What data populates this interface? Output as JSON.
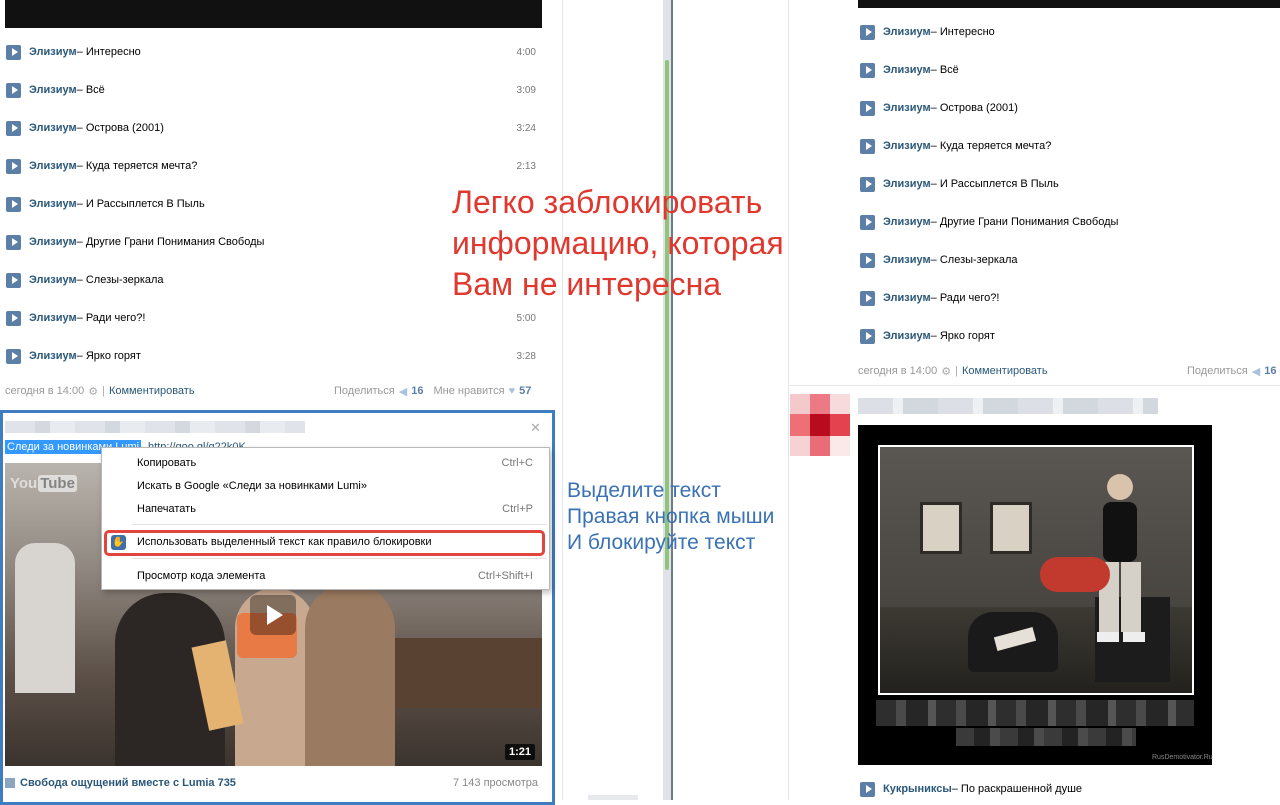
{
  "left_feed": {
    "audio": [
      {
        "artist": "Элизиум",
        "title": " – Интересно",
        "duration": "4:00"
      },
      {
        "artist": "Элизиум",
        "title": " – Всё",
        "duration": "3:09"
      },
      {
        "artist": "Элизиум",
        "title": " – Острова (2001)",
        "duration": "3:24"
      },
      {
        "artist": "Элизиум",
        "title": " – Куда теряется мечта?",
        "duration": "2:13"
      },
      {
        "artist": "Элизиум",
        "title": " – И Рассыплется В Пыль",
        "duration": ""
      },
      {
        "artist": "Элизиум",
        "title": " – Другие Грани Понимания Свободы",
        "duration": ""
      },
      {
        "artist": "Элизиум",
        "title": " – Слезы-зеркала",
        "duration": ""
      },
      {
        "artist": "Элизиум",
        "title": " – Ради чего?!",
        "duration": "5:00"
      },
      {
        "artist": "Элизиум",
        "title": " – Ярко горят",
        "duration": "3:28"
      }
    ],
    "meta": {
      "date": "сегодня в 14:00",
      "separator": "|",
      "comment": "Комментировать",
      "share": "Поделиться",
      "share_count": "16",
      "like": "Мне нравится",
      "like_count": "57"
    },
    "post": {
      "selected_text": "Следи за новинками Lumi",
      "url_text": "http://goo.gl/q22k0K",
      "close": "✕",
      "video": {
        "youtube_logo": "You",
        "youtube_logo_tube": "Tube",
        "duration": "1:21",
        "title": "Свобода ощущений вместе с Lumia 735",
        "views": "7 143 просмотра"
      }
    }
  },
  "context_menu": {
    "items": [
      {
        "label": "Копировать",
        "shortcut": "Ctrl+C"
      },
      {
        "label": "Искать в Google «Следи за новинками Lumi»",
        "shortcut": ""
      },
      {
        "label": "Напечатать",
        "shortcut": "Ctrl+P"
      },
      {
        "label": "Использовать выделенный текст как правило блокировки",
        "shortcut": ""
      },
      {
        "label": "Просмотр кода элемента",
        "shortcut": "Ctrl+Shift+I"
      }
    ]
  },
  "annotations": {
    "red": [
      "Легко заблокировать",
      "информацию, которая",
      "Вам не интересна"
    ],
    "blue": [
      "Выделите текст",
      "Правая кнопка мыши",
      "И блокируйте текст"
    ]
  },
  "right_feed": {
    "audio": [
      {
        "artist": "Элизиум",
        "title": " – Интересно"
      },
      {
        "artist": "Элизиум",
        "title": " – Всё"
      },
      {
        "artist": "Элизиум",
        "title": " – Острова (2001)"
      },
      {
        "artist": "Элизиум",
        "title": " – Куда теряется мечта?"
      },
      {
        "artist": "Элизиум",
        "title": " – И Рассыплется В Пыль"
      },
      {
        "artist": "Элизиум",
        "title": " – Другие Грани Понимания Свободы"
      },
      {
        "artist": "Элизиум",
        "title": " – Слезы-зеркала"
      },
      {
        "artist": "Элизиум",
        "title": " – Ради чего?!"
      },
      {
        "artist": "Элизиум",
        "title": " – Ярко горят"
      }
    ],
    "meta": {
      "date": "сегодня в 14:00",
      "separator": "|",
      "comment": "Комментировать",
      "share": "Поделиться",
      "share_count": "16"
    },
    "next_post": {
      "watermark": "RusDemotivator.Ru",
      "audio": {
        "artist": "Кукрыниксы",
        "title": " – По раскрашенной душе"
      }
    }
  },
  "colors": {
    "link": "#2b587a",
    "annotation_red": "#e0382f",
    "annotation_blue": "#3a72b5",
    "highlight_box": "#3e7dc2",
    "menu_highlight": "#e0463e",
    "selection": "#3399ff"
  }
}
